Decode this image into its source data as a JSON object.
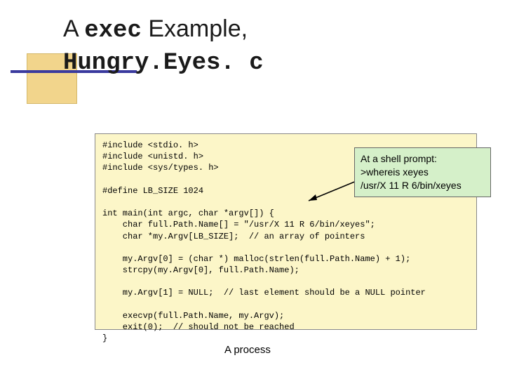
{
  "title": {
    "part1": "A ",
    "mono1": "exec",
    "part2": " Example,\n",
    "mono2": "Hungry.Eyes. c"
  },
  "code": "#include <stdio. h>\n#include <unistd. h>\n#include <sys/types. h>\n\n#define LB_SIZE 1024\n\nint main(int argc, char *argv[]) {\n    char full.Path.Name[] = \"/usr/X 11 R 6/bin/xeyes\";\n    char *my.Argv[LB_SIZE];  // an array of pointers\n\n    my.Argv[0] = (char *) malloc(strlen(full.Path.Name) + 1);\n    strcpy(my.Argv[0], full.Path.Name);\n\n    my.Argv[1] = NULL;  // last element should be a NULL pointer\n\n    execvp(full.Path.Name, my.Argv);\n    exit(0);  // should not be reached\n}",
  "callout": "At a shell prompt:\n>whereis xeyes\n/usr/X 11 R 6/bin/xeyes",
  "caption": "A process"
}
